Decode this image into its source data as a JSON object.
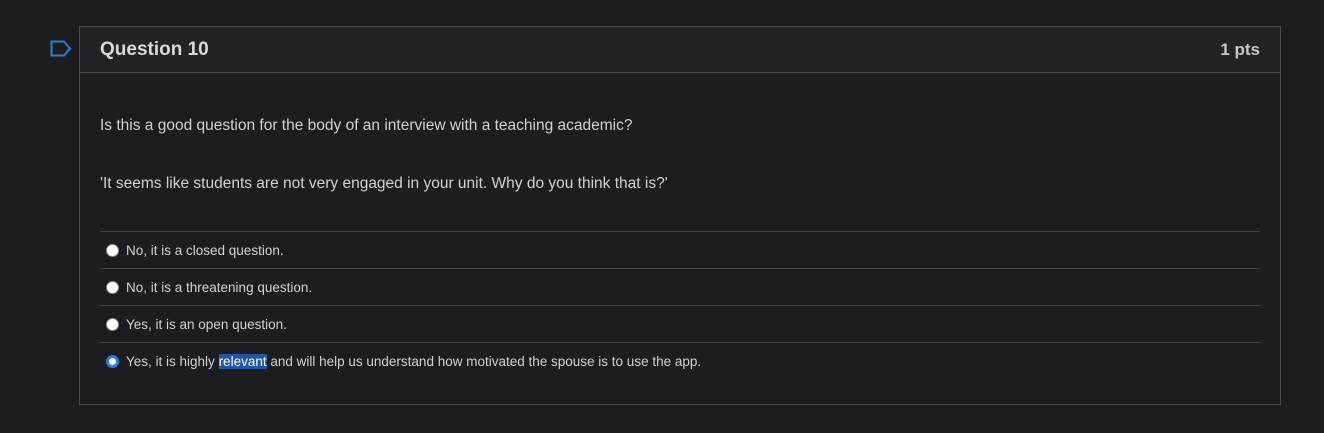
{
  "question": {
    "title": "Question 10",
    "points": "1 pts",
    "prompt": "Is this a good question for the body of an interview with a teaching academic?",
    "quote": "'It seems like students are not very engaged in your unit. Why do you think that is?'"
  },
  "answers": [
    {
      "label": "No, it is a closed question.",
      "selected": false
    },
    {
      "label": "No, it is a threatening question.",
      "selected": false
    },
    {
      "label": "Yes, it is an open question.",
      "selected": false
    },
    {
      "label_before": "Yes, it is highly ",
      "label_highlight": "relevant",
      "label_after": " and will help us understand how motivated the spouse is to use the app.",
      "selected": true
    }
  ],
  "colors": {
    "background": "#1c1d20",
    "header": "#232427",
    "border": "#4a4b4f",
    "selected_radio": "#2f7bd8",
    "text_highlight": "#1f56a8",
    "flag": "#2f7bd8"
  },
  "icons": {
    "flag": "bookmark-flag-icon"
  }
}
